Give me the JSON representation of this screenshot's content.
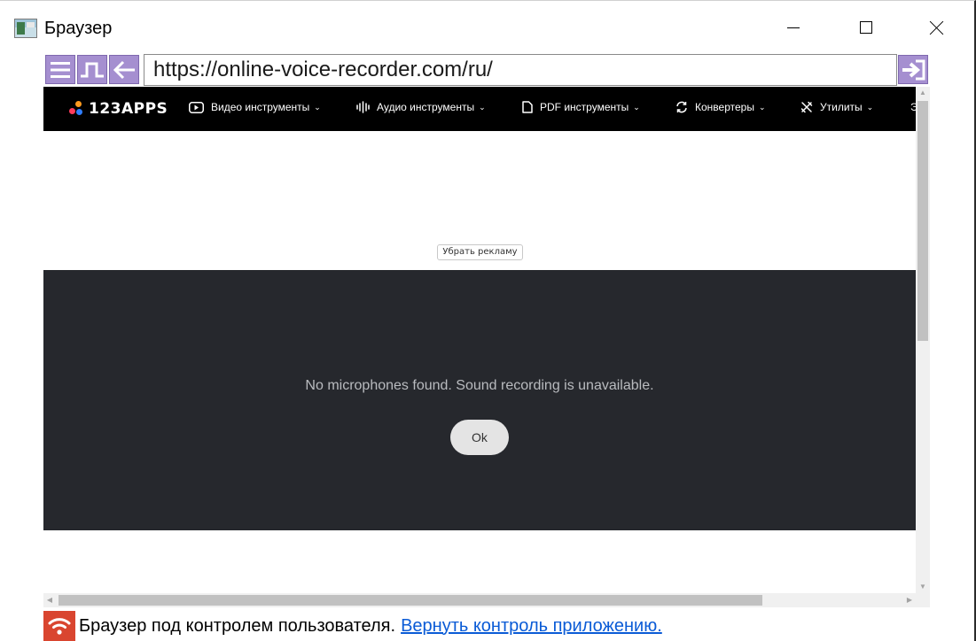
{
  "window": {
    "title": "Браузер"
  },
  "toolbar": {
    "url": "https://online-voice-recorder.com/ru/"
  },
  "site": {
    "logo": "123APPS",
    "nav": [
      {
        "label": "Видео инструменты",
        "icon": "play-icon"
      },
      {
        "label": "Аудио инструменты",
        "icon": "waveform-icon"
      },
      {
        "label": "PDF инструменты",
        "icon": "document-icon"
      },
      {
        "label": "Конвертеры",
        "icon": "convert-icon"
      },
      {
        "label": "Утилиты",
        "icon": "tools-icon"
      }
    ],
    "nav_more": "Э",
    "remove_ads": "Убрать рекламу",
    "message": "No microphones found. Sound recording is unavailable.",
    "ok": "Ok"
  },
  "status": {
    "text": "Браузер под контролем пользователя.",
    "link": "Вернуть контроль приложению."
  },
  "colors": {
    "toolbar_button": "#a58fd0",
    "nav_background": "#000000",
    "panel_background": "#26282d",
    "status_icon": "#d9452f",
    "link": "#0a5bd6"
  }
}
